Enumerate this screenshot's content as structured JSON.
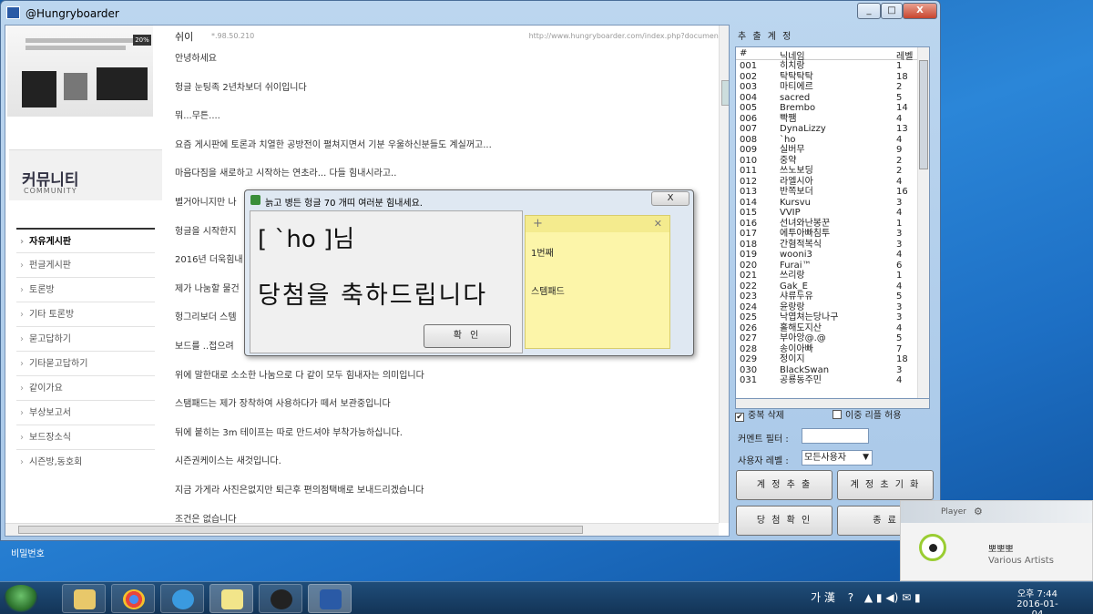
{
  "window": {
    "title": "@Hungryboarder",
    "controls": [
      "_",
      "□",
      "X"
    ]
  },
  "site": {
    "community_title": "커뮤니티",
    "community_sub": "COMMUNITY",
    "nav": [
      "자유게시판",
      "펀글게시판",
      "토론방",
      "기타 토론방",
      "묻고답하기",
      "기타묻고답하기",
      "같이가요",
      "부상보고서",
      "보드장소식",
      "시즌방,동호회"
    ]
  },
  "post": {
    "author": "쉬이",
    "ip": "*.98.50.210",
    "url": "http://www.hungryboarder.com/index.php?document",
    "lines": [
      "안녕하세요",
      "헝글 눈팅족 2년차보더 쉬이입니다",
      "뭐...무튼....",
      "요즘 게시판에 토론과 치열한 공방전이 펼쳐지면서 기분 우울하신분들도 계실꺼고...",
      "마음다짐을 새로하고 시작하는 연초라... 다들 힘내시라고..",
      "별거아니지만 나",
      "헝글을 시작한지",
      "2016년 더욱힘내",
      "제가 나눔할 물건",
      "헝그리보더 스템",
      "보드를 ..접으려",
      "위에 말한대로 소소한 나눔으로 다 같이 모두 힘내자는 의미입니다",
      "스탬패드는 제가 장착하여 사용하다가 떼서 보관중입니다",
      "뒤에 붙히는 3m 테이프는 따로 만드셔야 부착가능하십니다.",
      "시즌권케이스는 새것입니다.",
      "지금 가게라 사진은없지만 퇴근후 편의점택배로 보내드리겠습니다",
      "조건은 없습니다"
    ]
  },
  "panel": {
    "title": "추 출 계 정",
    "columns": [
      "#",
      "닉네임",
      "레벨"
    ],
    "rows": [
      [
        "001",
        "히치랑",
        "1"
      ],
      [
        "002",
        "탁탁탁탁",
        "18"
      ],
      [
        "003",
        "마티에르",
        "2"
      ],
      [
        "004",
        "sacred",
        "5"
      ],
      [
        "005",
        "Brembo",
        "14"
      ],
      [
        "006",
        "빡쨈",
        "4"
      ],
      [
        "007",
        "DynaLizzy",
        "13"
      ],
      [
        "008",
        "`ho",
        "4"
      ],
      [
        "009",
        "실버무",
        "9"
      ],
      [
        "010",
        "중약",
        "2"
      ],
      [
        "011",
        "쓰노보딩",
        "2"
      ],
      [
        "012",
        "라엘시아",
        "4"
      ],
      [
        "013",
        "반쪽보더",
        "16"
      ],
      [
        "014",
        "Kursvu",
        "3"
      ],
      [
        "015",
        "VVIP",
        "4"
      ],
      [
        "016",
        "선녀와난봉꾼",
        "1"
      ],
      [
        "017",
        "에투아빠침투",
        "3"
      ],
      [
        "018",
        "간혐적복식",
        "3"
      ],
      [
        "019",
        "wooni3",
        "4"
      ],
      [
        "020",
        "Furai™",
        "6"
      ],
      [
        "021",
        "쓰리랑",
        "1"
      ],
      [
        "022",
        "Gak_E",
        "4"
      ],
      [
        "023",
        "샤류두유",
        "5"
      ],
      [
        "024",
        "윤랑랑",
        "3"
      ],
      [
        "025",
        "낙엽쳐는당나구",
        "3"
      ],
      [
        "026",
        "홀해도지산",
        "4"
      ],
      [
        "027",
        "부아앙@.@",
        "5"
      ],
      [
        "028",
        "송이아빠",
        "7"
      ],
      [
        "029",
        "정이지",
        "18"
      ],
      [
        "030",
        "BlackSwan",
        "3"
      ],
      [
        "031",
        "공룡동주민",
        "4"
      ]
    ],
    "dedupe_label": "중복 삭제",
    "dedupe_checked": "✔",
    "double_reply_label": "이중 리플 허용",
    "comment_filter_label": "커멘트 필터 :",
    "comment_filter_value": "",
    "user_level_label": "사용자 레벨 :",
    "user_level_value": "모든사용자",
    "btn_extract": "계 정 추 출",
    "btn_reset": "계 정 초 기 화",
    "btn_check": "당 첨 확 인",
    "btn_exit": "종 료"
  },
  "dialog": {
    "title": "늙고 병든 헝글 70 개띠 여러분 힘내세요.",
    "close": "X",
    "line1": "[ `ho ]님",
    "line2": "당첨을 축하드립니다",
    "ok": "확 인",
    "sticky_line1": "1번째",
    "sticky_line2": "스템패드"
  },
  "desktop": {
    "label": "비밀번호"
  },
  "player": {
    "label": "Player",
    "song": "뽀뽀뽀",
    "artist": "Various Artists"
  },
  "taskbar": {
    "ime": "가 漢",
    "time": "오후 7:44",
    "date": "2016-01-04"
  }
}
